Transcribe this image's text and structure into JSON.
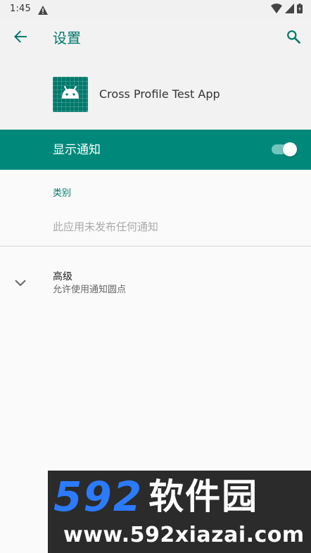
{
  "status_bar": {
    "time": "1:45"
  },
  "app_bar": {
    "title": "设置"
  },
  "app_header": {
    "app_name": "Cross Profile Test App"
  },
  "main_toggle": {
    "label": "显示通知",
    "checked": true
  },
  "categories": {
    "header": "类别",
    "empty_message": "此应用未发布任何通知"
  },
  "advanced": {
    "title": "高级",
    "summary": "允许使用通知圆点"
  },
  "watermark": {
    "brand_number": "592",
    "brand_text": "软件园",
    "url": "www.592xiazai.com"
  },
  "colors": {
    "accent": "#00796b",
    "toggle_row_bg": "#00897b",
    "background": "#fafafa",
    "watermark_blue": "#2c7bff"
  },
  "icons": {
    "status": [
      "warning-icon",
      "wifi-icon",
      "signal-icon",
      "battery-icon"
    ],
    "app_bar": [
      "back-arrow-icon",
      "search-icon"
    ],
    "advanced": "chevron-down-icon",
    "app": "android-icon"
  }
}
